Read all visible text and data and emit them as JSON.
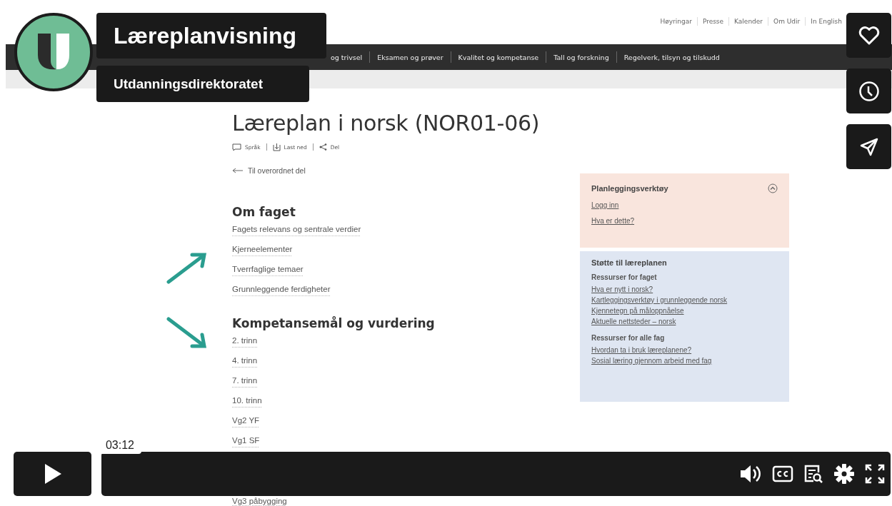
{
  "player": {
    "title": "Læreplanvisning",
    "byline": "Utdanningsdirektoratet",
    "time": "03:12"
  },
  "page": {
    "top_links": [
      "Høyringar",
      "Presse",
      "Kalender",
      "Om Udir",
      "In English"
    ],
    "nav": [
      "og trivsel",
      "Eksamen og prøver",
      "Kvalitet og kompetanse",
      "Tall og forskning",
      "Regelverk, tilsyn og tilskudd"
    ],
    "heading": "Læreplan i norsk (NOR01-06)",
    "tools": [
      {
        "kind": "language",
        "label": "Språk"
      },
      {
        "kind": "download",
        "label": "Last ned"
      },
      {
        "kind": "share",
        "label": "Del"
      }
    ],
    "back_link": "Til overordnet del",
    "sections": [
      {
        "title": "Om faget",
        "links": [
          "Fagets relevans og sentrale verdier",
          "Kjerneelementer",
          "Tverrfaglige temaer",
          "Grunnleggende ferdigheter"
        ]
      },
      {
        "title": "Kompetansemål og vurdering",
        "links": [
          "2. trinn",
          "4. trinn",
          "7. trinn",
          "10. trinn",
          "Vg2 YF",
          "Vg1 SF"
        ],
        "cut_link": "Vg3 påbygging"
      }
    ],
    "planning": {
      "title": "Planleggingsverktøy",
      "expanded": true,
      "links": [
        "Logg inn",
        "Hva er dette?"
      ]
    },
    "support": {
      "title": "Støtte til læreplanen",
      "groups": [
        {
          "title": "Ressurser for faget",
          "links": [
            "Hva er nytt i norsk?",
            "Kartleggingsverktøy i grunnleggende norsk",
            "Kjennetegn på måloppnåelse",
            "Aktuelle nettsteder – norsk"
          ]
        },
        {
          "title": "Ressurser for alle fag",
          "links": [
            "Hvordan ta i bruk læreplanene?",
            "Sosial læring gjennom arbeid med fag"
          ]
        }
      ]
    }
  }
}
